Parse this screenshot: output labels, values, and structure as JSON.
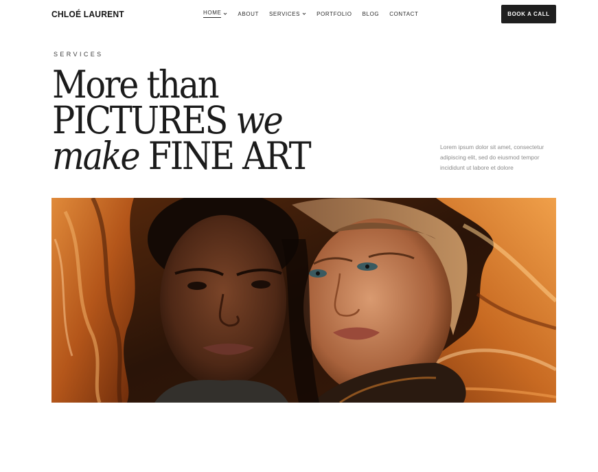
{
  "header": {
    "brand": "CHLOÉ LAURENT",
    "nav": [
      {
        "label": "HOME",
        "dropdown": true,
        "active": true
      },
      {
        "label": "ABOUT",
        "dropdown": false,
        "active": false
      },
      {
        "label": "SERVICES",
        "dropdown": true,
        "active": false
      },
      {
        "label": "PORTFOLIO",
        "dropdown": false,
        "active": false
      },
      {
        "label": "BLOG",
        "dropdown": false,
        "active": false
      },
      {
        "label": "CONTACT",
        "dropdown": false,
        "active": false
      }
    ],
    "cta_label": "BOOK A CALL"
  },
  "hero": {
    "eyebrow": "SERVICES",
    "headline": {
      "line1": "More than",
      "line2_plain": "PICTURES ",
      "line2_italic": "we",
      "line3_italic": "make",
      "line3_plain": " FINE ART"
    },
    "intro": "Lorem ipsum dolor sit amet, consectetur adipiscing elit, sed do eiusmod tempor incididunt ut labore et dolore"
  },
  "colors": {
    "text": "#1b1b1b",
    "muted": "#8a8a8a",
    "button_bg": "#1f1f1f",
    "photo_accent": "#c46a1f"
  }
}
